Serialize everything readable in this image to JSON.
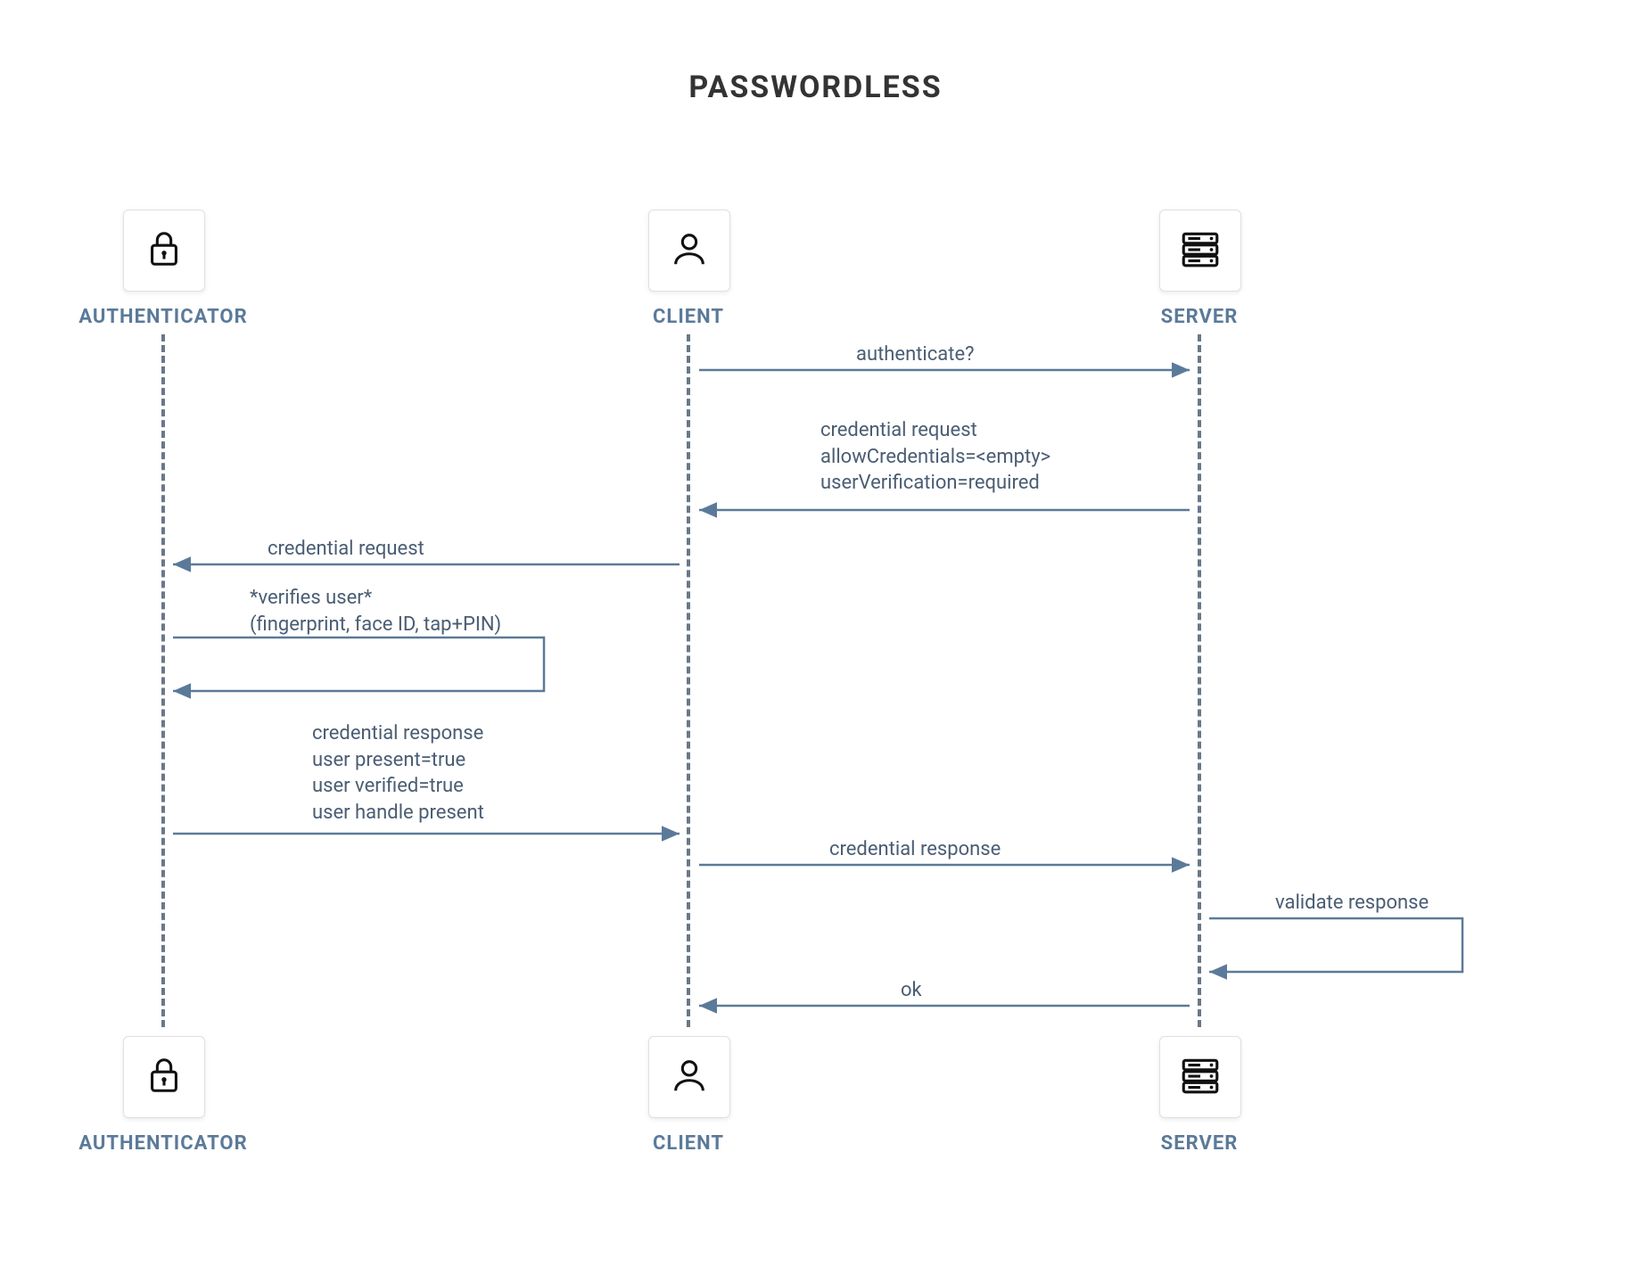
{
  "title": "PASSWORDLESS",
  "colors": {
    "line": "#5b7a99",
    "text": "#4a5d73",
    "title": "#333333"
  },
  "actors": {
    "authenticator": {
      "label": "AUTHENTICATOR",
      "icon": "lock"
    },
    "client": {
      "label": "CLIENT",
      "icon": "person"
    },
    "server": {
      "label": "SERVER",
      "icon": "server"
    }
  },
  "messages": {
    "m1": "authenticate?",
    "m2": "credential request\nallowCredentials=<empty>\nuserVerification=required",
    "m3": "credential request",
    "m4": "*verifies user*\n(fingerprint, face ID, tap+PIN)",
    "m5": "credential response\nuser present=true\nuser verified=true\nuser handle present",
    "m6": "credential response",
    "m7": "validate response",
    "m8": "ok"
  },
  "layout": {
    "x": {
      "auth": 183,
      "client": 772,
      "server": 1345
    },
    "topBoxY": 235,
    "topLabelY": 343,
    "bottomBoxY": 1162,
    "bottomLabelY": 1270,
    "lifeTop": 375,
    "lifeBottom": 1152
  }
}
